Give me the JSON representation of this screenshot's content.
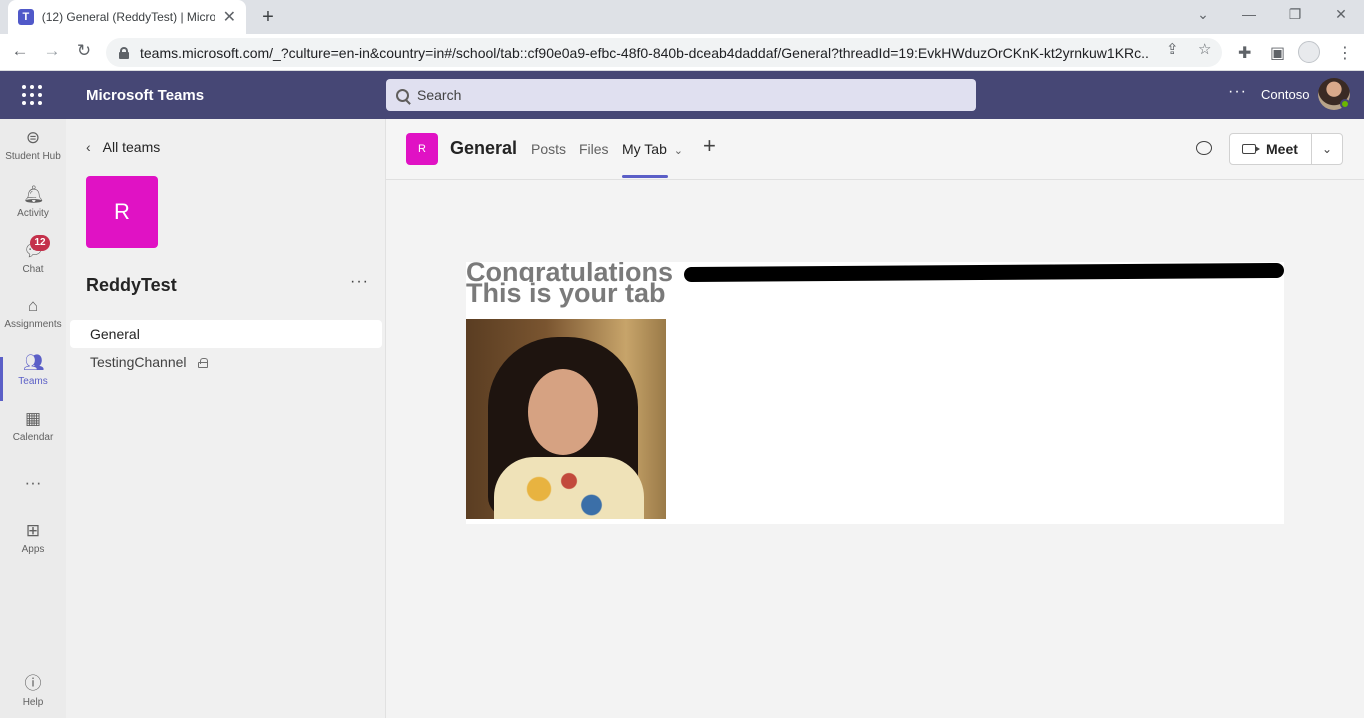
{
  "browser": {
    "tab_title": "(12) General (ReddyTest) | Micros",
    "tab_close": "✕",
    "new_tab": "+",
    "url": "teams.microsoft.com/_?culture=en-in&country=in#/school/tab::cf90e0a9-efbc-48f0-840b-dceab4daddaf/General?threadId=19:EvkHWduzOrCKnK-kt2yrnkuw1KRc..."
  },
  "header": {
    "app_name": "Microsoft Teams",
    "search_placeholder": "Search",
    "more": "···",
    "org": "Contoso"
  },
  "rail": {
    "items": [
      {
        "label": "Student Hub",
        "icon": "student-hub-icon"
      },
      {
        "label": "Activity",
        "icon": "bell-icon"
      },
      {
        "label": "Chat",
        "icon": "chat-icon",
        "badge": "12"
      },
      {
        "label": "Assignments",
        "icon": "backpack-icon"
      },
      {
        "label": "Teams",
        "icon": "teams-icon",
        "active": true
      },
      {
        "label": "Calendar",
        "icon": "calendar-icon"
      },
      {
        "label": "",
        "icon": "more-icon"
      },
      {
        "label": "Apps",
        "icon": "apps-icon"
      },
      {
        "label": "Help",
        "icon": "help-icon"
      }
    ]
  },
  "team_pane": {
    "back_label": "All teams",
    "team_initial": "R",
    "team_name": "ReddyTest",
    "more": "···",
    "channels": [
      {
        "name": "General",
        "selected": true
      },
      {
        "name": "TestingChannel",
        "private": true
      }
    ]
  },
  "channel_header": {
    "avatar_initial": "R",
    "title": "General",
    "tabs": [
      {
        "label": "Posts"
      },
      {
        "label": "Files"
      },
      {
        "label": "My Tab",
        "active": true,
        "chevron": "⌄"
      }
    ],
    "add_tab": "+",
    "meet_label": "Meet",
    "meet_dropdown": "⌄"
  },
  "tab_content": {
    "congrats": "Congratulations",
    "subtitle": "This is your tab"
  },
  "colors": {
    "teams_purple": "#464775",
    "accent": "#5b5fc7",
    "team_avatar": "#e012c4",
    "badge": "#c4314b"
  }
}
